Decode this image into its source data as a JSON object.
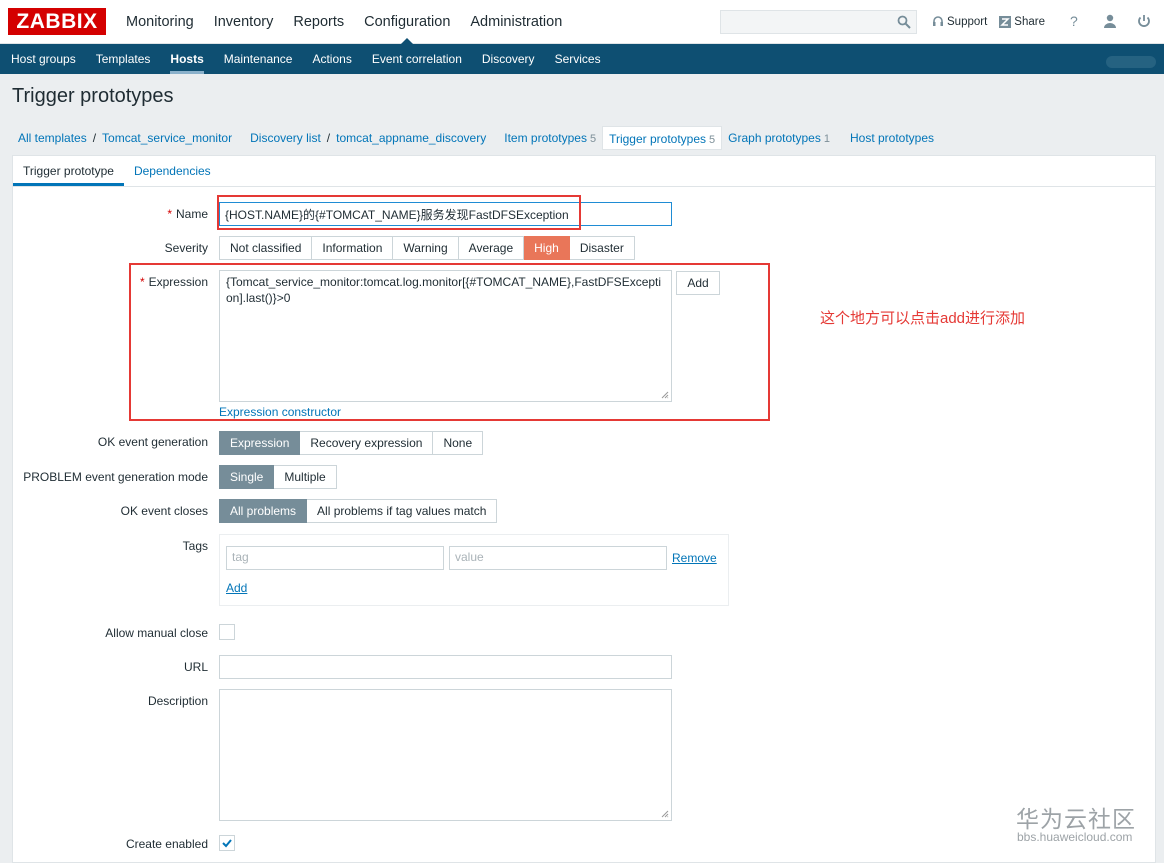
{
  "brand": {
    "logo": "ZABBIX",
    "color": "#d40000"
  },
  "main_menu": [
    "Monitoring",
    "Inventory",
    "Reports",
    "Configuration",
    "Administration"
  ],
  "main_menu_active": "Configuration",
  "top_links": {
    "support": "Support",
    "share": "Share",
    "help": "?"
  },
  "sub_menu": [
    "Host groups",
    "Templates",
    "Hosts",
    "Maintenance",
    "Actions",
    "Event correlation",
    "Discovery",
    "Services"
  ],
  "sub_menu_active": "Hosts",
  "page_title": "Trigger prototypes",
  "breadcrumbs": {
    "all_templates": "All templates",
    "template": "Tomcat_service_monitor",
    "discovery_list": "Discovery list",
    "discovery_rule": "tomcat_appname_discovery",
    "item_prototypes": "Item prototypes",
    "item_prototypes_count": "5",
    "trigger_prototypes": "Trigger prototypes",
    "trigger_prototypes_count": "5",
    "graph_prototypes": "Graph prototypes",
    "graph_prototypes_count": "1",
    "host_prototypes": "Host prototypes"
  },
  "form_tabs": [
    "Trigger prototype",
    "Dependencies"
  ],
  "form": {
    "name_label": "Name",
    "name_value": "{HOST.NAME}的{#TOMCAT_NAME}服务发现FastDFSException",
    "severity_label": "Severity",
    "severity_options": [
      "Not classified",
      "Information",
      "Warning",
      "Average",
      "High",
      "Disaster"
    ],
    "severity_selected": "High",
    "expression_label": "Expression",
    "expression_value": "{Tomcat_service_monitor:tomcat.log.monitor[{#TOMCAT_NAME},FastDFSException].last()}>0",
    "add_button": "Add",
    "expression_constructor": "Expression constructor",
    "ok_event_generation_label": "OK event generation",
    "ok_event_generation_options": [
      "Expression",
      "Recovery expression",
      "None"
    ],
    "problem_mode_label": "PROBLEM event generation mode",
    "problem_mode_options": [
      "Single",
      "Multiple"
    ],
    "ok_event_closes_label": "OK event closes",
    "ok_event_closes_options": [
      "All problems",
      "All problems if tag values match"
    ],
    "tags_label": "Tags",
    "tag_placeholder": "tag",
    "value_placeholder": "value",
    "remove_link": "Remove",
    "add_link": "Add",
    "allow_manual_close_label": "Allow manual close",
    "allow_manual_close_checked": false,
    "url_label": "URL",
    "url_value": "",
    "description_label": "Description",
    "description_value": "",
    "create_enabled_label": "Create enabled",
    "create_enabled_checked": true
  },
  "annotation": "这个地方可以点击add进行添加",
  "watermark": {
    "title": "华为云社区",
    "url": "bbs.huaweicloud.com"
  }
}
